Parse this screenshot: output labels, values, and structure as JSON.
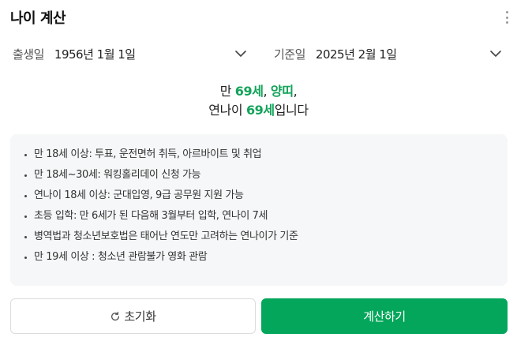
{
  "header": {
    "title": "나이 계산",
    "more_icon": "more-vertical-icon"
  },
  "birth": {
    "label": "출생일",
    "value": "1956년 1월 1일"
  },
  "base": {
    "label": "기준일",
    "value": "2025년 2월 1일"
  },
  "result": {
    "prefix": "만 ",
    "age": "69세",
    "sep": ", ",
    "zodiac": "양띠",
    "suffix": ",",
    "line2_prefix": "연나이 ",
    "korean_age": "69세",
    "line2_suffix": "입니다"
  },
  "info": [
    "만 18세 이상: 투표, 운전면허 취득, 아르바이트 및 취업",
    "만 18세~30세: 워킹홀리데이 신청 가능",
    "연나이 18세 이상: 군대입영, 9급 공무원 지원 가능",
    "초등 입학: 만 6세가 된 다음해 3월부터 입학, 연나이 7세",
    "병역법과 청소년보호법은 태어난 연도만 고려하는 연나이가 기준",
    "만 19세 이상 : 청소년 관람불가 영화 관람"
  ],
  "buttons": {
    "reset": "초기화",
    "calculate": "계산하기"
  },
  "colors": {
    "accent": "#03a65a",
    "highlight": "#13a35a"
  }
}
